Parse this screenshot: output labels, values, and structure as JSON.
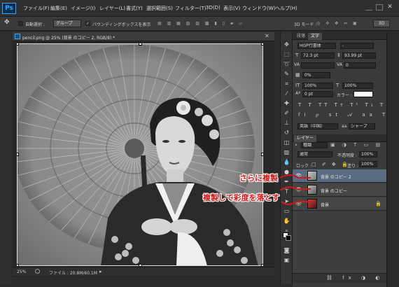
{
  "app": {
    "logo": "Ps",
    "menu": [
      "ファイル(F)",
      "編集(E)",
      "イメージ(I)",
      "レイヤー(L)",
      "書式(Y)",
      "選択範囲(S)",
      "フィルター(T)",
      "3D(D)",
      "表示(V)",
      "ウィンドウ(W)",
      "ヘルプ(H)"
    ],
    "accent": "#31a8ff"
  },
  "options": {
    "auto_select_label": "自動選択 :",
    "auto_select_value": "グループ",
    "bounding_box_label": "バウンディングボックスを表示",
    "mode_3d_label": "3D モード :",
    "workspace": "3D"
  },
  "document": {
    "tab_title": "pencil.png @ 25% (背景 のコピー 2, RGB/8) *",
    "zoom": "25%",
    "file_info": "ファイル : 20.8M/60.1M"
  },
  "char_panel": {
    "tabs": [
      "段落",
      "文字"
    ],
    "font_family": "HGP行書体",
    "font_style": "-",
    "size": "72.3 pt",
    "leading": "93.99 pt",
    "kerning": "",
    "tracking": "0",
    "tsume": "0%",
    "vscale": "100%",
    "hscale": "100%",
    "baseline": "0 pt",
    "color_label": "カラー :",
    "language": "英語（中国）",
    "aa": "aa",
    "aa_value": "シャープ"
  },
  "layers_panel": {
    "tab": "レイヤー",
    "filter_kind": "種類",
    "blend_mode": "通常",
    "opacity_label": "不透明度 :",
    "opacity": "100%",
    "lock_label": "ロック :",
    "fill_label": "塗り :",
    "fill": "100%",
    "layers": [
      {
        "name": "背景 のコピー 2",
        "selected": true
      },
      {
        "name": "背景 のコピー",
        "selected": false
      },
      {
        "name": "背景",
        "selected": false,
        "locked": true
      }
    ]
  },
  "annotations": {
    "top": "さらに複製",
    "bottom": "複製して彩度を落とす",
    "color": "#d41818"
  }
}
